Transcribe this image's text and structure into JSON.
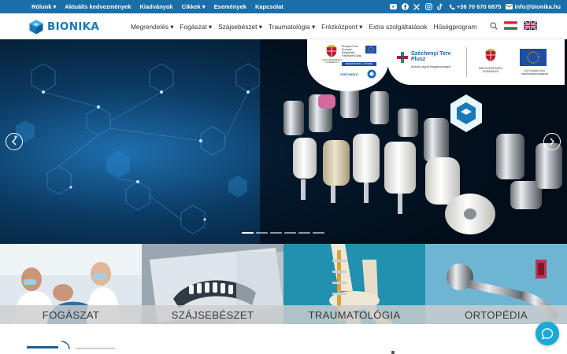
{
  "topbar": {
    "links": [
      "Rólunk",
      "Aktuális kedvezmények",
      "Kiadványok",
      "Cikkek",
      "Események",
      "Kapcsolat"
    ],
    "phone": "+36 70 670 6875",
    "email": "info@bionika.hu",
    "social_icons": [
      "youtube-icon",
      "facebook-icon",
      "x-icon",
      "instagram-icon",
      "tiktok-icon"
    ]
  },
  "nav": {
    "logo_text": "BIONIKA",
    "menu": [
      "Megrendelés",
      "Fogászat",
      "Szájsebészet",
      "Traumatológia",
      "Frézközpont",
      "Extra szolgáltatások",
      "Hűségprogram"
    ],
    "languages": [
      "hu",
      "en"
    ]
  },
  "hero": {
    "badge_left": {
      "line1": "Európai Unió",
      "line2": "Európai Regionális",
      "line3": "Fejlesztési Alap",
      "gov": "MAGYARORSZÁG KORMÁNYA",
      "cta": "BEFEKTETÉS A JÖVŐBE",
      "szechenyi": "SZÉCHENYI"
    },
    "badge_right": {
      "title": "Széchenyi Terv Plusz",
      "subtitle": "Építsük együtt Magyarországot!",
      "gov": "MAGYARORSZÁG KORMÁNYA",
      "eu": "Az Európai Unió társfinanszírozásával"
    },
    "slides": 6,
    "active_slide": 1
  },
  "categories": [
    {
      "label": "FOGÁSZAT"
    },
    {
      "label": "SZÁJSEBÉSZET"
    },
    {
      "label": "TRAUMATOLÓGIA"
    },
    {
      "label": "ORTOPÉDIA"
    }
  ],
  "colors": {
    "topbar": "#1b6fa8",
    "brand": "#1b78b8",
    "chat": "#1ba8d6"
  }
}
